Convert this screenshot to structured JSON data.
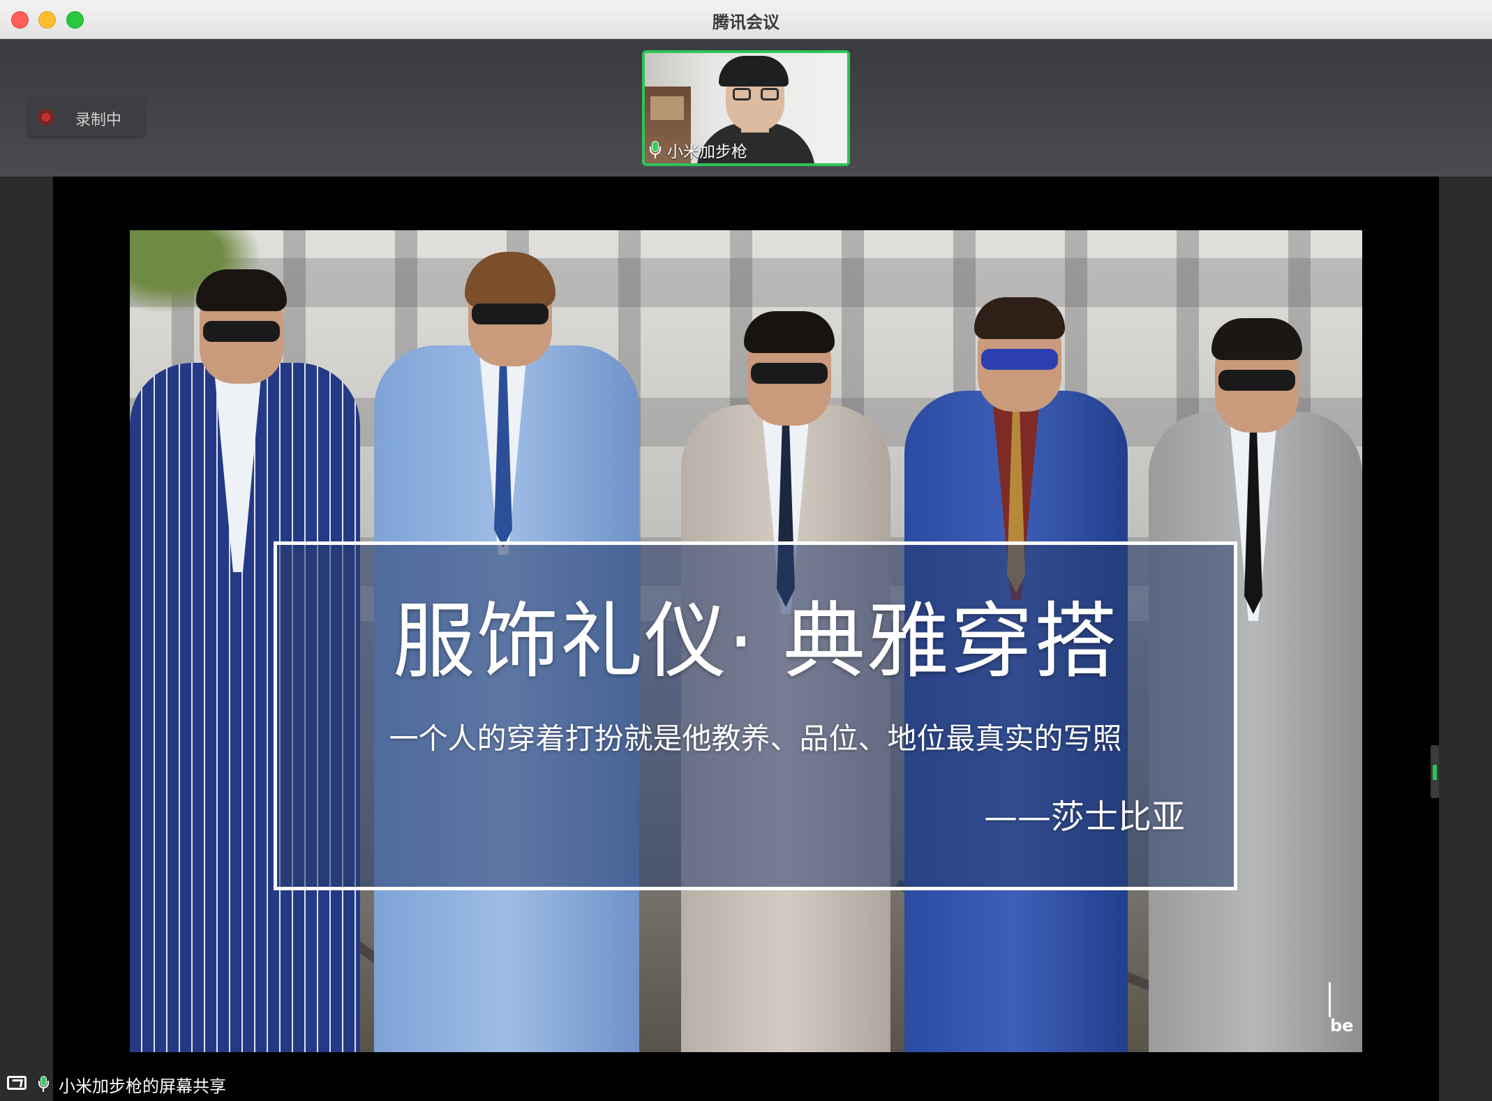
{
  "window": {
    "title": "腾讯会议"
  },
  "recording": {
    "label": "录制中"
  },
  "participant": {
    "name": "小米加步枪",
    "mic": "mic-on-icon"
  },
  "slide": {
    "title": "服饰礼仪· 典雅穿搭",
    "subtitle": "一个人的穿着打扮就是他教养、品位、地位最真实的写照",
    "attribution": "——莎士比亚",
    "watermark": "be"
  },
  "share": {
    "label": "小米加步枪的屏幕共享"
  },
  "colors": {
    "active_speaker_border": "#2fc35a",
    "mic_active": "#2fd15f",
    "recording_dot": "#c0312b"
  }
}
